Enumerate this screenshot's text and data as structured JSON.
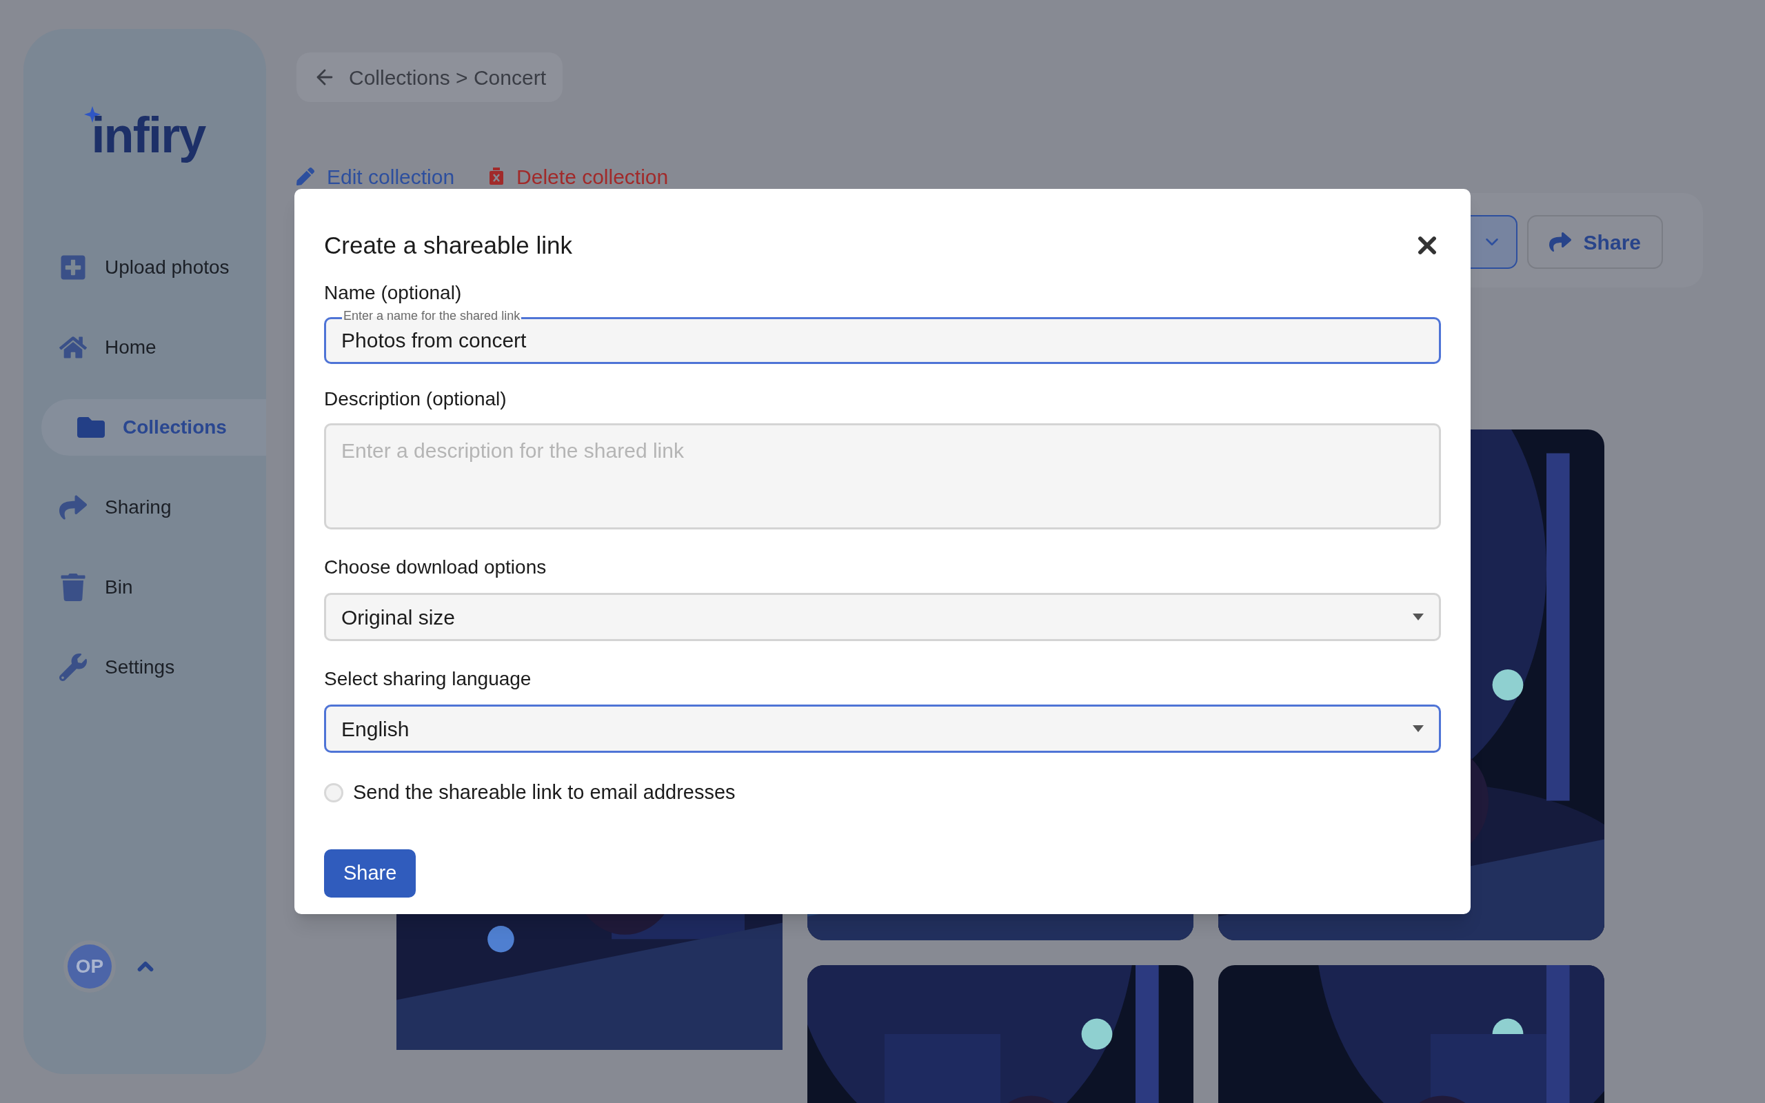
{
  "sidebar": {
    "logo": "infiry",
    "items": [
      {
        "label": "Upload photos",
        "selected": false
      },
      {
        "label": "Home",
        "selected": false
      },
      {
        "label": "Collections",
        "selected": true
      },
      {
        "label": "Sharing",
        "selected": false
      },
      {
        "label": "Bin",
        "selected": false
      },
      {
        "label": "Settings",
        "selected": false
      }
    ],
    "user": {
      "initials": "OP"
    }
  },
  "breadcrumb": "Collections > Concert",
  "actions": [
    {
      "label": "Edit collection",
      "kind": "edit"
    },
    {
      "label": "Delete collection",
      "kind": "delete"
    }
  ],
  "toolbar": {
    "share_label": "Share"
  },
  "dialog": {
    "title": "Create a shareable link",
    "name": {
      "label": "Name (optional)",
      "floating_label": "Enter a name for the shared link",
      "value": "Photos from concert",
      "focused": true
    },
    "description": {
      "label": "Description (optional)",
      "placeholder": "Enter a description for the shared link",
      "focused": false
    },
    "download": {
      "label": "Choose download options",
      "value": "Original size",
      "focused": false
    },
    "language": {
      "label": "Select sharing language",
      "value": "English",
      "focused": true
    },
    "email_option": {
      "label": "Send the shareable link to email addresses",
      "checked": false
    },
    "submit": "Share"
  }
}
